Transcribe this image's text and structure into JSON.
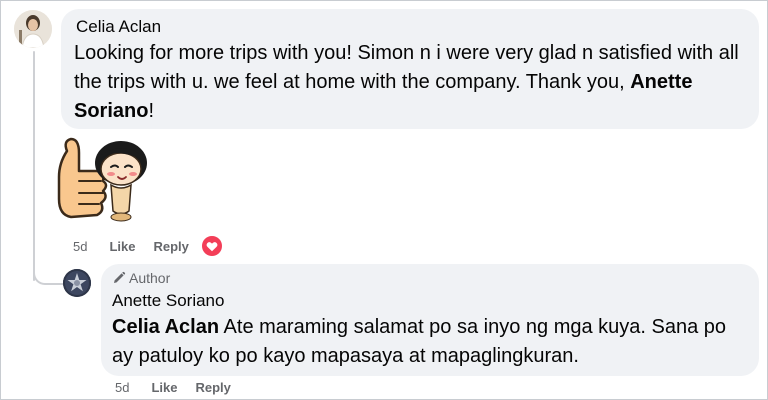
{
  "main_comment": {
    "author": "Celia Aclan",
    "text_before": "Looking for more trips with you! Simon n i were very glad n satisfied with all the trips with u. we feel at home with the company. Thank you, ",
    "mention": "Anette Soriano",
    "text_after": "!",
    "time": "5d",
    "like_label": "Like",
    "reply_label": "Reply",
    "reaction_icon": "love-reaction-icon",
    "sticker": "thumbs-up-girl-sticker"
  },
  "reply_comment": {
    "badge_icon": "pencil-icon",
    "badge_label": "Author",
    "author": "Anette Soriano",
    "mention": "Celia Aclan",
    "text": " Ate maraming salamat po sa inyo ng mga kuya. Sana po ay patuloy ko po kayo mapasaya at mapaglingkuran.",
    "time": "5d",
    "like_label": "Like",
    "reply_label": "Reply"
  },
  "colors": {
    "bubble_bg": "#f0f2f5",
    "meta_text": "#65676b",
    "love_reaction": "#f33e58",
    "thread_line": "#ced0d4"
  }
}
